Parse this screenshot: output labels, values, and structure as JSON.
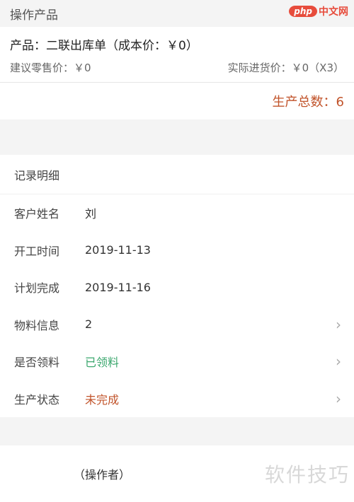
{
  "header": {
    "title": "操作产品"
  },
  "brand": {
    "php": "php",
    "cn": "中文网"
  },
  "product": {
    "name": "产品：二联出库单（成本价：￥0）",
    "suggested_price": "建议零售价：￥0",
    "actual_price": "实际进货价：￥0（X3）"
  },
  "total": {
    "label": "生产总数：6"
  },
  "detail": {
    "title": "记录明细",
    "rows": [
      {
        "label": "客户姓名",
        "value": "刘"
      },
      {
        "label": "开工时间",
        "value": "2019-11-13"
      },
      {
        "label": "计划完成",
        "value": "2019-11-16"
      },
      {
        "label": "物料信息",
        "value": "2"
      },
      {
        "label": "是否领料",
        "value": "已领料"
      },
      {
        "label": "生产状态",
        "value": "未完成"
      }
    ]
  },
  "footer": {
    "operator": "（操作者）"
  },
  "watermark": {
    "text": "软件技巧"
  },
  "colors": {
    "accent": "#c1532a",
    "green": "#3aa76d",
    "brand": "#e74c3c"
  }
}
